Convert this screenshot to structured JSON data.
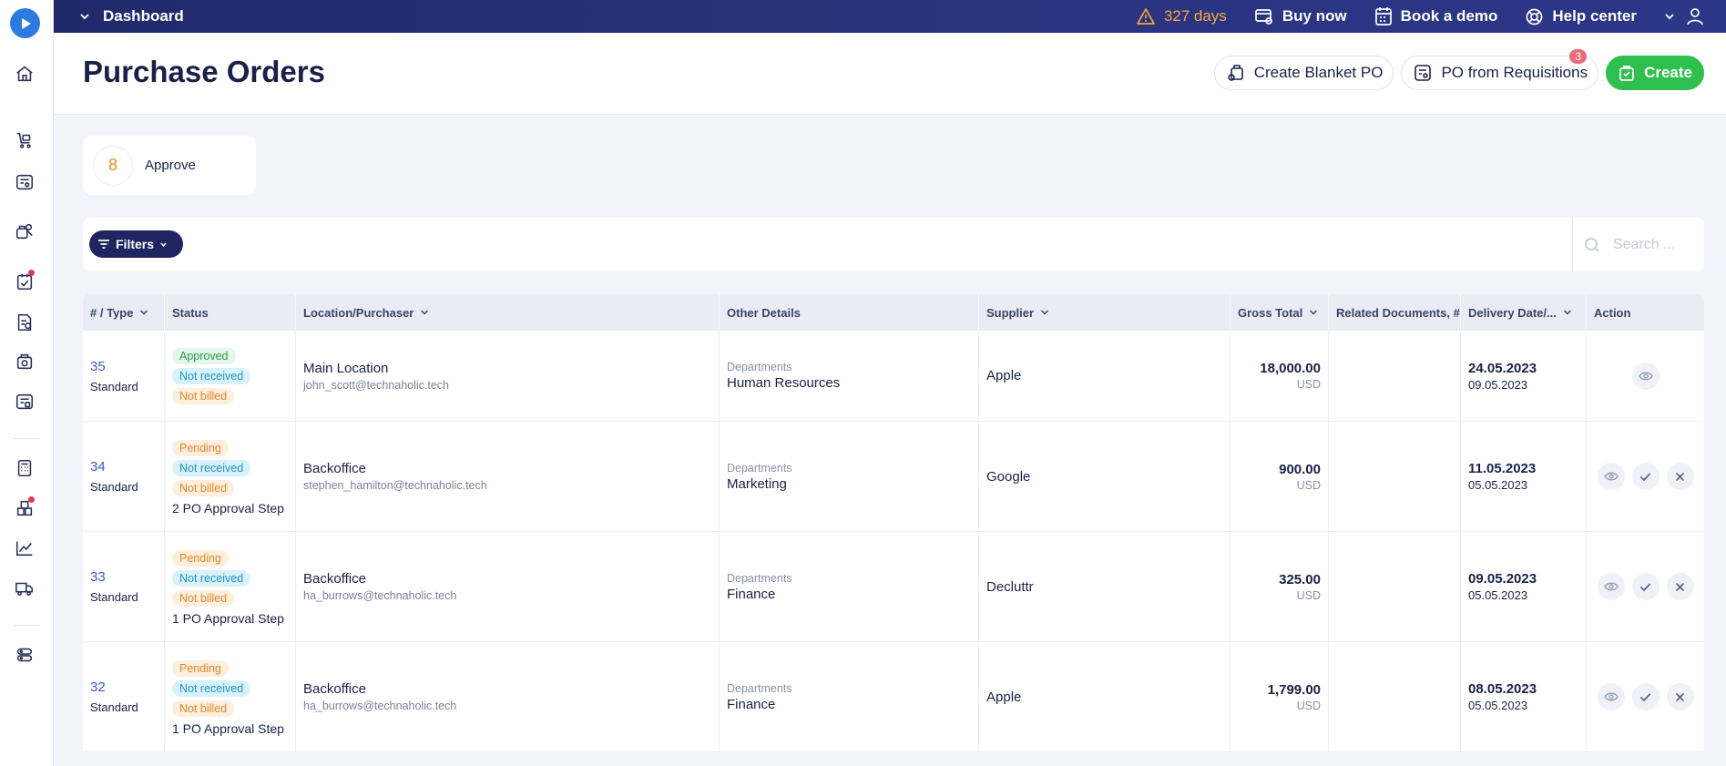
{
  "topbar": {
    "dashboard_label": "Dashboard",
    "trial_days": "327 days",
    "buy_now": "Buy now",
    "book_demo": "Book a demo",
    "help_center": "Help center"
  },
  "header": {
    "title": "Purchase Orders",
    "create_blanket": "Create Blanket PO",
    "po_from_requisitions": "PO from Requisitions",
    "requisitions_badge": "3",
    "create": "Create"
  },
  "approve_card": {
    "count": "8",
    "label": "Approve"
  },
  "filters": {
    "label": "Filters",
    "search_placeholder": "Search ..."
  },
  "table": {
    "columns": {
      "type": "# / Type",
      "status": "Status",
      "location": "Location/Purchaser",
      "other": "Other Details",
      "supplier": "Supplier",
      "gross": "Gross Total",
      "related": "Related Documents, #",
      "delivery": "Delivery Date/...",
      "action": "Action"
    },
    "rows": [
      {
        "num": "35",
        "type": "Standard",
        "status": [
          "Approved",
          "Not received",
          "Not billed"
        ],
        "approval": "",
        "location": "Main Location",
        "email": "john_scott@technaholic.tech",
        "dep_label": "Departments",
        "department": "Human Resources",
        "supplier": "Apple",
        "amount": "18,000.00",
        "currency": "USD",
        "delivery": "24.05.2023",
        "date": "09.05.2023"
      },
      {
        "num": "34",
        "type": "Standard",
        "status": [
          "Pending",
          "Not received",
          "Not billed"
        ],
        "approval": "2 PO Approval Step",
        "location": "Backoffice",
        "email": "stephen_hamilton@technaholic.tech",
        "dep_label": "Departments",
        "department": "Marketing",
        "supplier": "Google",
        "amount": "900.00",
        "currency": "USD",
        "delivery": "11.05.2023",
        "date": "05.05.2023"
      },
      {
        "num": "33",
        "type": "Standard",
        "status": [
          "Pending",
          "Not received",
          "Not billed"
        ],
        "approval": "1 PO Approval Step",
        "location": "Backoffice",
        "email": "ha_burrows@technaholic.tech",
        "dep_label": "Departments",
        "department": "Finance",
        "supplier": "Decluttr",
        "amount": "325.00",
        "currency": "USD",
        "delivery": "09.05.2023",
        "date": "05.05.2023"
      },
      {
        "num": "32",
        "type": "Standard",
        "status": [
          "Pending",
          "Not received",
          "Not billed"
        ],
        "approval": "1 PO Approval Step",
        "location": "Backoffice",
        "email": "ha_burrows@technaholic.tech",
        "dep_label": "Departments",
        "department": "Finance",
        "supplier": "Apple",
        "amount": "1,799.00",
        "currency": "USD",
        "delivery": "08.05.2023",
        "date": "05.05.2023"
      }
    ]
  }
}
